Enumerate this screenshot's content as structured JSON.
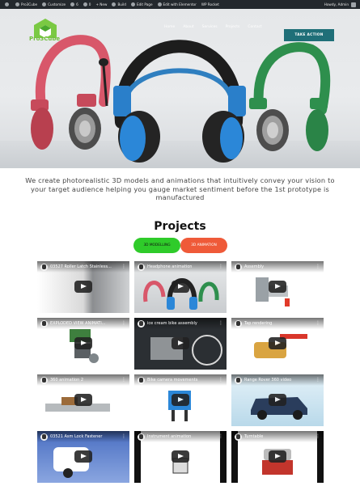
{
  "admin_bar": {
    "site_name": "Pro3Cube",
    "customize": "Customize",
    "updates_count": "6",
    "comments_count": "0",
    "new": "New",
    "build": "Build",
    "edit_page": "Edit Page",
    "edit_with": "Edit with Elementor",
    "wprocket": "WP Rocket",
    "greeting": "Howdy, Admin"
  },
  "header": {
    "logo_text": "Pro3Cube",
    "nav": [
      "Home",
      "About",
      "Services",
      "Projects",
      "Contact"
    ],
    "cta": "TAKE ACTION"
  },
  "tagline": "We create photorealistic 3D models and animations that intuitively convey your vision to your target audience helping you gauge market sentiment before the 1st prototype is manufactured",
  "projects": {
    "title": "Projects",
    "filters": [
      "3D MODELLING",
      "3D ANIMATION"
    ],
    "videos": [
      "03527 Roller Latch Stainless...",
      "Headphone animation",
      "Assembly",
      "EXPLODED VIEW ANIMATI...",
      "ice cream bike assembly",
      "Tap rendering",
      "360 animation 2",
      "Bike camera movements",
      "Range Rover 360 video",
      "03521 Asm Lock Fastener",
      "Instrument animation",
      "Turntable"
    ]
  },
  "colors": {
    "admin_bar": "#23282d",
    "cta": "#1f6f78",
    "filter_active": "#2fcb2a",
    "filter_secondary": "#ef5a39"
  }
}
